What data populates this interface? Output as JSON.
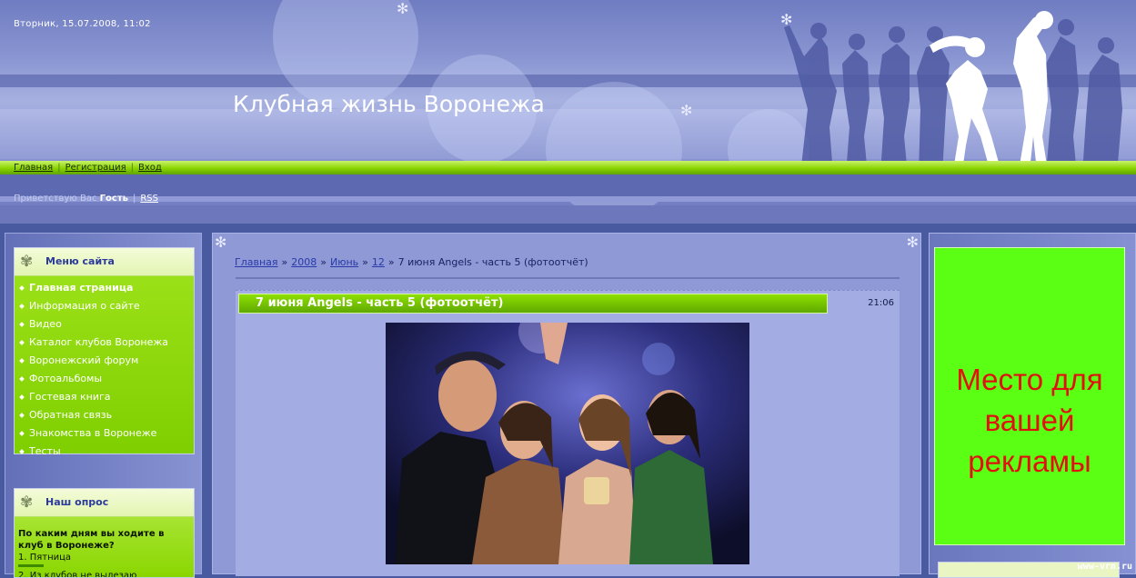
{
  "header": {
    "datetime": "Вторник, 15.07.2008, 11:02",
    "site_title": "Клубная жизнь Воронежа",
    "nav": [
      "Главная",
      "Регистрация",
      "Вход"
    ],
    "greeting_prefix": "Приветствую Вас",
    "greeting_user": "Гость",
    "rss": "RSS"
  },
  "sidebar": {
    "menu_title": "Меню сайта",
    "menu_items": [
      "Главная страница",
      "Информация о сайте",
      "Видео",
      "Каталог клубов Воронежа",
      "Воронежский форум",
      "Фотоальбомы",
      "Гостевая книга",
      "Обратная связь",
      "Знакомства в Воронеже",
      "Тесты"
    ],
    "poll_title": "Наш опрос",
    "poll_question": "По каким дням вы ходите в клуб в Воронеже?",
    "poll_options": [
      "1. Пятница",
      "2. Из клубов не вылезаю"
    ]
  },
  "content": {
    "breadcrumb": [
      "Главная",
      "2008",
      "Июнь",
      "12",
      "7 июня Angels - часть 5 (фотоотчёт)"
    ],
    "entry_title": "7 июня Angels - часть 5 (фотоотчёт)",
    "entry_time": "21:06"
  },
  "ad": {
    "lines": [
      "Место для",
      "вашей",
      "рекламы"
    ]
  },
  "watermark": "www-vrn.ru",
  "colors": {
    "accent_green": "#7fcf00",
    "ad_bg": "#5bff13",
    "ad_text": "#e0110e",
    "header_blue": "#8c98d3",
    "link_blue": "#2a3aa8"
  }
}
